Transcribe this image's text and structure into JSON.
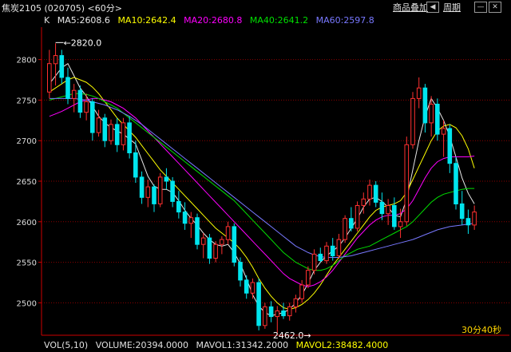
{
  "title": "焦炭2105 (020705) <60分>",
  "toolbar": {
    "link_label": "商品叠加",
    "period_label": "周期"
  },
  "ma_legend": [
    {
      "label": "K",
      "color": "#e0e0e0"
    },
    {
      "label": "MA5:2608.6",
      "color": "#e8e8e8"
    },
    {
      "label": "MA10:2642.4",
      "color": "#ffff00"
    },
    {
      "label": "MA20:2680.8",
      "color": "#ff00ff"
    },
    {
      "label": "MA40:2641.2",
      "color": "#00e000"
    },
    {
      "label": "MA60:2597.8",
      "color": "#7878ff"
    }
  ],
  "timer": "30分40秒",
  "vol_legend": [
    {
      "label": "VOL(5,10)",
      "color": "#e0e0e0"
    },
    {
      "label": "VOLUME:20394.0000",
      "color": "#e0e0e0"
    },
    {
      "label": "MAVOL1:31342.2000",
      "color": "#e0e0e0"
    },
    {
      "label": "MAVOL2:38482.4000",
      "color": "#ffff00"
    }
  ],
  "chart_data": {
    "type": "candlestick",
    "ylim": [
      2460,
      2840
    ],
    "yticks": [
      2500,
      2550,
      2600,
      2650,
      2700,
      2750,
      2800
    ],
    "annotations": [
      {
        "label": "2820.0",
        "value": 2820,
        "index": 1
      },
      {
        "label": "2462.0",
        "value": 2462,
        "index": 43
      }
    ],
    "ohlc": [
      [
        2760,
        2812,
        2752,
        2795
      ],
      [
        2795,
        2820,
        2768,
        2805
      ],
      [
        2805,
        2812,
        2770,
        2778
      ],
      [
        2778,
        2790,
        2745,
        2752
      ],
      [
        2752,
        2770,
        2735,
        2762
      ],
      [
        2762,
        2768,
        2728,
        2735
      ],
      [
        2735,
        2758,
        2725,
        2748
      ],
      [
        2748,
        2752,
        2700,
        2710
      ],
      [
        2710,
        2738,
        2705,
        2728
      ],
      [
        2728,
        2733,
        2692,
        2700
      ],
      [
        2700,
        2726,
        2695,
        2720
      ],
      [
        2720,
        2728,
        2686,
        2695
      ],
      [
        2695,
        2728,
        2688,
        2722
      ],
      [
        2722,
        2730,
        2678,
        2685
      ],
      [
        2685,
        2700,
        2648,
        2655
      ],
      [
        2655,
        2662,
        2622,
        2630
      ],
      [
        2630,
        2652,
        2618,
        2643
      ],
      [
        2643,
        2646,
        2612,
        2622
      ],
      [
        2622,
        2660,
        2618,
        2655
      ],
      [
        2655,
        2666,
        2640,
        2650
      ],
      [
        2650,
        2655,
        2618,
        2625
      ],
      [
        2625,
        2638,
        2604,
        2612
      ],
      [
        2612,
        2624,
        2590,
        2598
      ],
      [
        2598,
        2612,
        2580,
        2605
      ],
      [
        2605,
        2610,
        2566,
        2572
      ],
      [
        2572,
        2586,
        2555,
        2580
      ],
      [
        2580,
        2585,
        2548,
        2555
      ],
      [
        2555,
        2576,
        2550,
        2572
      ],
      [
        2572,
        2582,
        2560,
        2578
      ],
      [
        2578,
        2600,
        2572,
        2594
      ],
      [
        2594,
        2598,
        2545,
        2550
      ],
      [
        2550,
        2556,
        2520,
        2528
      ],
      [
        2528,
        2534,
        2505,
        2512
      ],
      [
        2512,
        2530,
        2505,
        2525
      ],
      [
        2525,
        2530,
        2466,
        2472
      ],
      [
        2472,
        2500,
        2468,
        2495
      ],
      [
        2495,
        2502,
        2476,
        2483
      ],
      [
        2483,
        2496,
        2462,
        2490
      ],
      [
        2490,
        2500,
        2480,
        2484
      ],
      [
        2484,
        2500,
        2478,
        2495
      ],
      [
        2495,
        2510,
        2488,
        2505
      ],
      [
        2505,
        2528,
        2500,
        2522
      ],
      [
        2522,
        2545,
        2518,
        2540
      ],
      [
        2540,
        2566,
        2535,
        2560
      ],
      [
        2560,
        2568,
        2550,
        2552
      ],
      [
        2552,
        2575,
        2548,
        2570
      ],
      [
        2570,
        2580,
        2552,
        2558
      ],
      [
        2558,
        2585,
        2554,
        2578
      ],
      [
        2578,
        2608,
        2574,
        2604
      ],
      [
        2604,
        2618,
        2588,
        2592
      ],
      [
        2592,
        2625,
        2588,
        2620
      ],
      [
        2620,
        2636,
        2610,
        2628
      ],
      [
        2628,
        2652,
        2620,
        2645
      ],
      [
        2645,
        2650,
        2618,
        2624
      ],
      [
        2624,
        2636,
        2602,
        2610
      ],
      [
        2610,
        2628,
        2596,
        2620
      ],
      [
        2620,
        2630,
        2590,
        2594
      ],
      [
        2594,
        2616,
        2580,
        2600
      ],
      [
        2600,
        2705,
        2595,
        2695
      ],
      [
        2695,
        2760,
        2690,
        2752
      ],
      [
        2752,
        2778,
        2740,
        2765
      ],
      [
        2765,
        2770,
        2710,
        2722
      ],
      [
        2722,
        2755,
        2705,
        2745
      ],
      [
        2745,
        2752,
        2700,
        2708
      ],
      [
        2708,
        2725,
        2680,
        2715
      ],
      [
        2715,
        2720,
        2660,
        2672
      ],
      [
        2672,
        2680,
        2615,
        2622
      ],
      [
        2622,
        2638,
        2596,
        2604
      ],
      [
        2604,
        2615,
        2585,
        2596
      ],
      [
        2596,
        2620,
        2590,
        2612
      ]
    ],
    "ma": [
      {
        "name": "MA5",
        "color": "#e8e8e8",
        "values": [
          2770,
          2780,
          2790,
          2795,
          2780,
          2765,
          2755,
          2742,
          2730,
          2722,
          2716,
          2712,
          2708,
          2702,
          2696,
          2676,
          2656,
          2644,
          2640,
          2640,
          2636,
          2626,
          2614,
          2604,
          2596,
          2586,
          2578,
          2572,
          2570,
          2572,
          2562,
          2548,
          2530,
          2510,
          2496,
          2488,
          2484,
          2486,
          2488,
          2492,
          2500,
          2510,
          2524,
          2540,
          2550,
          2558,
          2564,
          2570,
          2580,
          2592,
          2604,
          2618,
          2628,
          2630,
          2625,
          2618,
          2608,
          2606,
          2628,
          2664,
          2700,
          2730,
          2752,
          2740,
          2725,
          2705,
          2680,
          2654,
          2635,
          2622
        ]
      },
      {
        "name": "MA10",
        "color": "#ffff00",
        "values": [
          2760,
          2765,
          2770,
          2775,
          2778,
          2775,
          2772,
          2766,
          2758,
          2748,
          2738,
          2728,
          2720,
          2712,
          2704,
          2694,
          2684,
          2674,
          2664,
          2656,
          2648,
          2640,
          2632,
          2624,
          2616,
          2608,
          2600,
          2592,
          2586,
          2580,
          2574,
          2566,
          2556,
          2544,
          2530,
          2518,
          2508,
          2500,
          2494,
          2492,
          2494,
          2498,
          2504,
          2512,
          2522,
          2534,
          2546,
          2556,
          2566,
          2576,
          2586,
          2596,
          2606,
          2614,
          2618,
          2620,
          2622,
          2626,
          2636,
          2652,
          2668,
          2684,
          2700,
          2712,
          2718,
          2720,
          2716,
          2706,
          2690,
          2666
        ]
      },
      {
        "name": "MA20",
        "color": "#ff00ff",
        "values": [
          2730,
          2733,
          2736,
          2740,
          2744,
          2748,
          2750,
          2752,
          2752,
          2750,
          2748,
          2744,
          2740,
          2734,
          2728,
          2720,
          2712,
          2704,
          2696,
          2688,
          2680,
          2672,
          2664,
          2656,
          2648,
          2640,
          2632,
          2624,
          2616,
          2608,
          2600,
          2592,
          2584,
          2576,
          2568,
          2560,
          2552,
          2544,
          2536,
          2530,
          2526,
          2522,
          2520,
          2522,
          2526,
          2532,
          2540,
          2550,
          2560,
          2570,
          2580,
          2588,
          2596,
          2602,
          2606,
          2608,
          2608,
          2610,
          2616,
          2626,
          2640,
          2654,
          2666,
          2674,
          2678,
          2680,
          2680,
          2680,
          2680,
          2681
        ]
      },
      {
        "name": "MA40",
        "color": "#00e000",
        "values": [
          2750,
          2752,
          2754,
          2756,
          2758,
          2758,
          2757,
          2755,
          2752,
          2748,
          2744,
          2740,
          2734,
          2728,
          2722,
          2716,
          2710,
          2704,
          2698,
          2692,
          2686,
          2680,
          2674,
          2668,
          2662,
          2656,
          2650,
          2644,
          2638,
          2632,
          2626,
          2618,
          2610,
          2602,
          2594,
          2586,
          2578,
          2570,
          2562,
          2556,
          2550,
          2546,
          2542,
          2540,
          2540,
          2542,
          2546,
          2552,
          2558,
          2562,
          2566,
          2568,
          2570,
          2574,
          2578,
          2582,
          2586,
          2590,
          2594,
          2600,
          2608,
          2616,
          2624,
          2630,
          2634,
          2636,
          2638,
          2640,
          2641,
          2641
        ]
      },
      {
        "name": "MA60",
        "color": "#7878ff",
        "values": [
          2752,
          2752,
          2752,
          2752,
          2752,
          2751,
          2750,
          2748,
          2746,
          2744,
          2741,
          2738,
          2734,
          2730,
          2725,
          2720,
          2714,
          2708,
          2702,
          2696,
          2690,
          2684,
          2678,
          2672,
          2666,
          2660,
          2654,
          2648,
          2642,
          2636,
          2630,
          2624,
          2618,
          2612,
          2606,
          2600,
          2594,
          2588,
          2582,
          2576,
          2570,
          2566,
          2562,
          2559,
          2557,
          2556,
          2556,
          2556,
          2557,
          2558,
          2560,
          2562,
          2564,
          2566,
          2568,
          2570,
          2572,
          2574,
          2576,
          2578,
          2581,
          2584,
          2587,
          2590,
          2592,
          2594,
          2595,
          2596,
          2597,
          2598
        ]
      }
    ]
  }
}
